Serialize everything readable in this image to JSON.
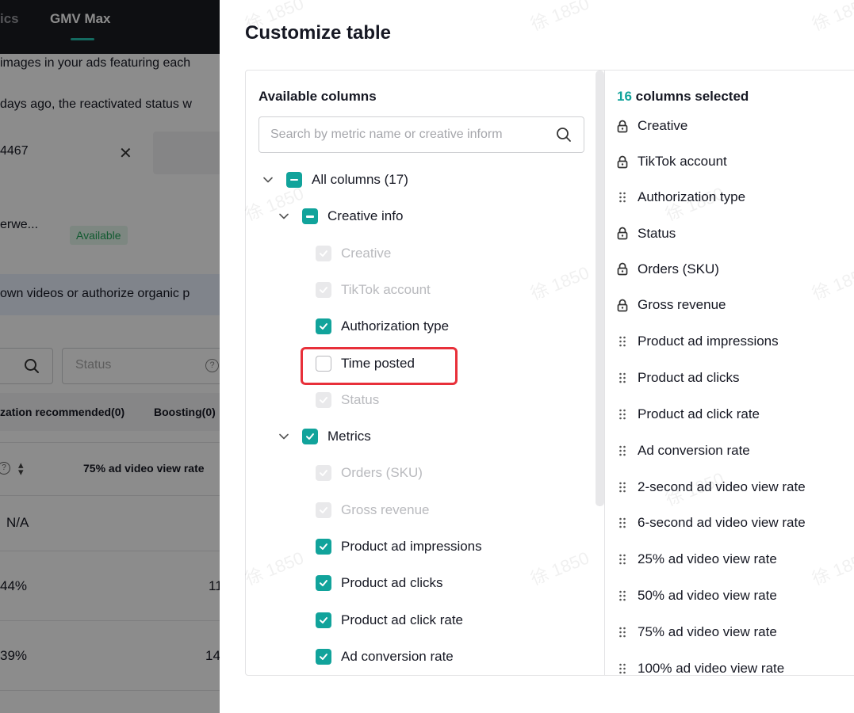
{
  "background": {
    "tabs": [
      {
        "label": "ics"
      },
      {
        "label": "GMV Max"
      }
    ],
    "texts": [
      {
        "text": "images in your ads featuring each"
      },
      {
        "text": "days ago, the reactivated status w"
      },
      {
        "text": "4467"
      },
      {
        "text": "erwe..."
      }
    ],
    "available_badge": "Available",
    "banner_text": "own videos or authorize organic p",
    "status_placeholder": "Status",
    "filters": [
      "zation recommended(0)",
      "Boosting(0)"
    ],
    "column_header": "75% ad video view rate",
    "rows": [
      {
        "col1": "N/A",
        "col2": ""
      },
      {
        "col1": "44%",
        "col2": "11"
      },
      {
        "col1": "39%",
        "col2": "14"
      }
    ]
  },
  "drawer": {
    "title": "Customize table",
    "available": {
      "heading": "Available columns",
      "search_placeholder": "Search by metric name or creative inform",
      "tree": [
        {
          "label": "All columns (17)",
          "state": "indeterminate",
          "level": 0,
          "expandable": true
        },
        {
          "label": "Creative info",
          "state": "indeterminate",
          "level": 1,
          "expandable": true
        },
        {
          "label": "Creative",
          "state": "disabled",
          "level": 2
        },
        {
          "label": "TikTok account",
          "state": "disabled",
          "level": 2
        },
        {
          "label": "Authorization type",
          "state": "checked",
          "level": 2
        },
        {
          "label": "Time posted",
          "state": "unchecked",
          "level": 2
        },
        {
          "label": "Status",
          "state": "disabled",
          "level": 2
        },
        {
          "label": "Metrics",
          "state": "checked",
          "level": 1,
          "expandable": true
        },
        {
          "label": "Orders (SKU)",
          "state": "disabled",
          "level": 2
        },
        {
          "label": "Gross revenue",
          "state": "disabled",
          "level": 2
        },
        {
          "label": "Product ad impressions",
          "state": "checked",
          "level": 2
        },
        {
          "label": "Product ad clicks",
          "state": "checked",
          "level": 2
        },
        {
          "label": "Product ad click rate",
          "state": "checked",
          "level": 2
        },
        {
          "label": "Ad conversion rate",
          "state": "checked",
          "level": 2
        }
      ]
    },
    "selected": {
      "count": "16",
      "heading_suffix": " columns selected",
      "items": [
        {
          "label": "Creative",
          "icon": "lock-icon"
        },
        {
          "label": "TikTok account",
          "icon": "lock-icon"
        },
        {
          "label": "Authorization type",
          "icon": "drag-handle-icon"
        },
        {
          "label": "Status",
          "icon": "lock-icon"
        },
        {
          "label": "Orders (SKU)",
          "icon": "lock-icon"
        },
        {
          "label": "Gross revenue",
          "icon": "lock-icon"
        },
        {
          "label": "Product ad impressions",
          "icon": "drag-handle-icon"
        },
        {
          "label": "Product ad clicks",
          "icon": "drag-handle-icon"
        },
        {
          "label": "Product ad click rate",
          "icon": "drag-handle-icon"
        },
        {
          "label": "Ad conversion rate",
          "icon": "drag-handle-icon"
        },
        {
          "label": "2-second ad video view rate",
          "icon": "drag-handle-icon"
        },
        {
          "label": "6-second ad video view rate",
          "icon": "drag-handle-icon"
        },
        {
          "label": "25% ad video view rate",
          "icon": "drag-handle-icon"
        },
        {
          "label": "50% ad video view rate",
          "icon": "drag-handle-icon"
        },
        {
          "label": "75% ad video view rate",
          "icon": "drag-handle-icon"
        },
        {
          "label": "100% ad video view rate",
          "icon": "drag-handle-icon"
        }
      ]
    }
  },
  "watermark": "徐 1850",
  "colors": {
    "accent": "#11a39b",
    "highlight": "#e8303a",
    "overlay": "rgba(0,0,0,0.45)",
    "topbar": "#1b1c22"
  }
}
